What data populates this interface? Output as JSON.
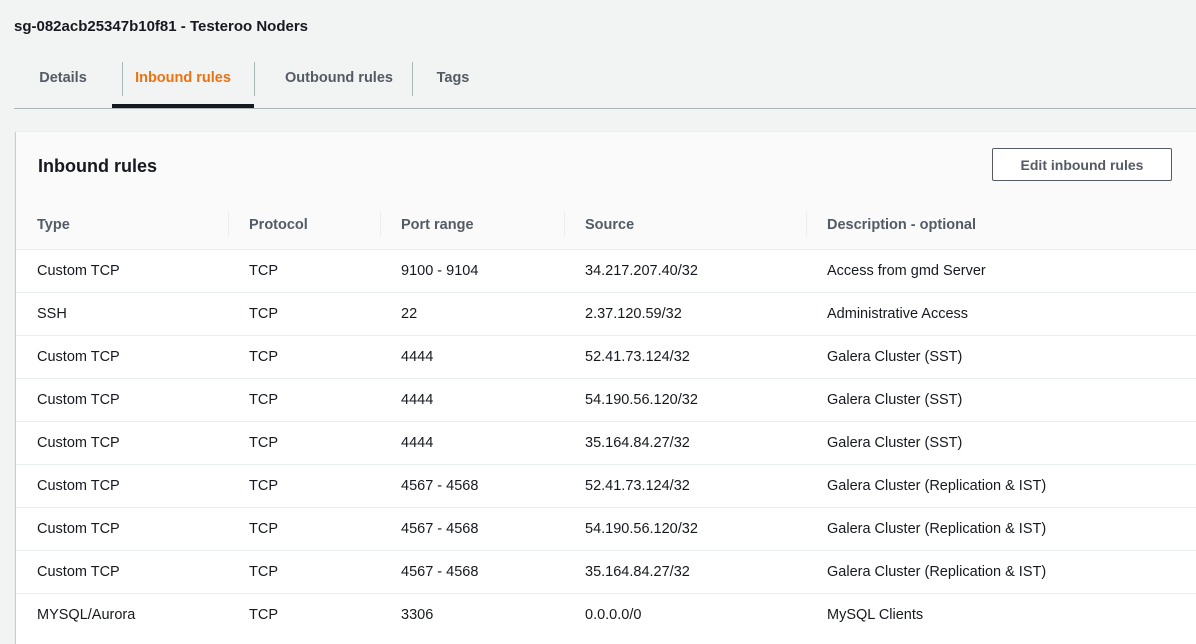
{
  "page": {
    "title": "sg-082acb25347b10f81 - Testeroo Noders"
  },
  "tabs": [
    {
      "label": "Details",
      "active": false
    },
    {
      "label": "Inbound rules",
      "active": true
    },
    {
      "label": "Outbound rules",
      "active": false
    },
    {
      "label": "Tags",
      "active": false
    }
  ],
  "panel": {
    "title": "Inbound rules",
    "edit_button_label": "Edit inbound rules"
  },
  "table": {
    "columns": [
      "Type",
      "Protocol",
      "Port range",
      "Source",
      "Description - optional"
    ],
    "rows": [
      [
        "Custom TCP",
        "TCP",
        "9100 - 9104",
        "34.217.207.40/32",
        "Access from gmd Server"
      ],
      [
        "SSH",
        "TCP",
        "22",
        "2.37.120.59/32",
        "Administrative Access"
      ],
      [
        "Custom TCP",
        "TCP",
        "4444",
        "52.41.73.124/32",
        "Galera Cluster (SST)"
      ],
      [
        "Custom TCP",
        "TCP",
        "4444",
        "54.190.56.120/32",
        "Galera Cluster (SST)"
      ],
      [
        "Custom TCP",
        "TCP",
        "4444",
        "35.164.84.27/32",
        "Galera Cluster (SST)"
      ],
      [
        "Custom TCP",
        "TCP",
        "4567 - 4568",
        "52.41.73.124/32",
        "Galera Cluster (Replication & IST)"
      ],
      [
        "Custom TCP",
        "TCP",
        "4567 - 4568",
        "54.190.56.120/32",
        "Galera Cluster (Replication & IST)"
      ],
      [
        "Custom TCP",
        "TCP",
        "4567 - 4568",
        "35.164.84.27/32",
        "Galera Cluster (Replication & IST)"
      ],
      [
        "MYSQL/Aurora",
        "TCP",
        "3306",
        "0.0.0.0/0",
        "MySQL Clients"
      ]
    ]
  },
  "colors": {
    "accent": "#ec7211",
    "text": "#16191f",
    "muted": "#545b64",
    "border": "#eaeded"
  }
}
